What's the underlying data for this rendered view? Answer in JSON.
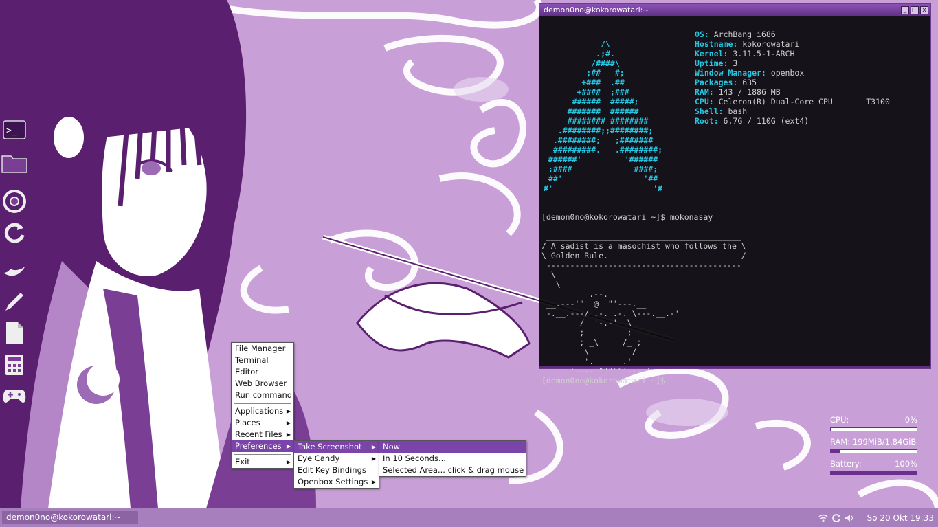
{
  "dock": {
    "icons": [
      "terminal-icon",
      "folder-icon",
      "chrome-icon",
      "refresh-icon",
      "bird-icon",
      "pen-icon",
      "document-icon",
      "calculator-icon",
      "gamepad-icon"
    ]
  },
  "terminal": {
    "title": "demon0no@kokorowatari:~",
    "buttons": {
      "minimize": "_",
      "maximize": "□",
      "close": "x"
    },
    "logo": "            /\\\n           .;#.\n          /####\\\n         ;##   #;\n        +###  .##\n       +####  ;###\n      ######  #####;\n     #######  ######\n     ######## ########\n   .########;;########;\n  .########;   ;#######\n  #########.   .########;\n ######'         '######\n ;####             ####;\n ##'                 '##\n#'                     '#",
    "info": [
      {
        "k": "OS:",
        "v": " ArchBang i686"
      },
      {
        "k": "Hostname:",
        "v": " kokorowatari"
      },
      {
        "k": "Kernel:",
        "v": " 3.11.5-1-ARCH"
      },
      {
        "k": "Uptime:",
        "v": " 3"
      },
      {
        "k": "Window Manager:",
        "v": " openbox"
      },
      {
        "k": "Packages:",
        "v": " 635"
      },
      {
        "k": "RAM:",
        "v": " 143 / 1886 MB"
      },
      {
        "k": "CPU:",
        "v": " Celeron(R) Dual-Core CPU       T3100"
      },
      {
        "k": "Shell:",
        "v": " bash"
      },
      {
        "k": "Root:",
        "v": " 6,7G / 110G (ext4)"
      }
    ],
    "prompt_cmd": "[demon0no@kokorowatari ~]$ mokonasay",
    "cowsay": " _________________________________________\n/ A sadist is a masochist who follows the \\\n\\ Golden Rule.                            /\n -----------------------------------------\n  \\\n   \\\n          .--.\n __.---'\"  @  \"'---.__\n'-.__.---/ .-. .-. \\---.__.-'\n        /  '-.-'  \\\n        ;         ;\n        ; _\\     /_ ;\n         \\         /\n       __'.      .'__\n      '----'\"\"\"\"\"'----'",
    "prompt_last": "[demon0no@kokorowatari ~]$ _"
  },
  "menu_main": {
    "items": [
      "File Manager",
      "Terminal",
      "Editor",
      "Web Browser",
      "Run command"
    ],
    "submenus": [
      "Applications",
      "Places",
      "Recent Files",
      "Preferences"
    ],
    "exit": "Exit"
  },
  "menu_prefs": {
    "items": [
      "Take Screenshot",
      "Eye Candy",
      "Edit Key Bindings",
      "Openbox Settings"
    ]
  },
  "menu_screenshot": {
    "items": [
      "Now",
      "In 10 Seconds...",
      "Selected Area... click & drag mouse"
    ]
  },
  "conky": {
    "cpu_label": "CPU:",
    "cpu_value": "0%",
    "cpu_fraction": 0.0,
    "ram_label": "RAM: 199MiB/1.84GiB",
    "ram_fraction": 0.1,
    "battery_label": "Battery:",
    "battery_value": "100%",
    "battery_fraction": 1.0
  },
  "taskbar": {
    "task_label": "demon0no@kokorowatari:~",
    "clock": "So 20 Okt 19:33",
    "tray_icons": [
      "wifi-icon",
      "update-icon",
      "volume-icon"
    ]
  },
  "colors": {
    "accent": "#7b44a8",
    "terminal_cyan": "#27c6e0",
    "wallpaper": "#c99fd8"
  }
}
